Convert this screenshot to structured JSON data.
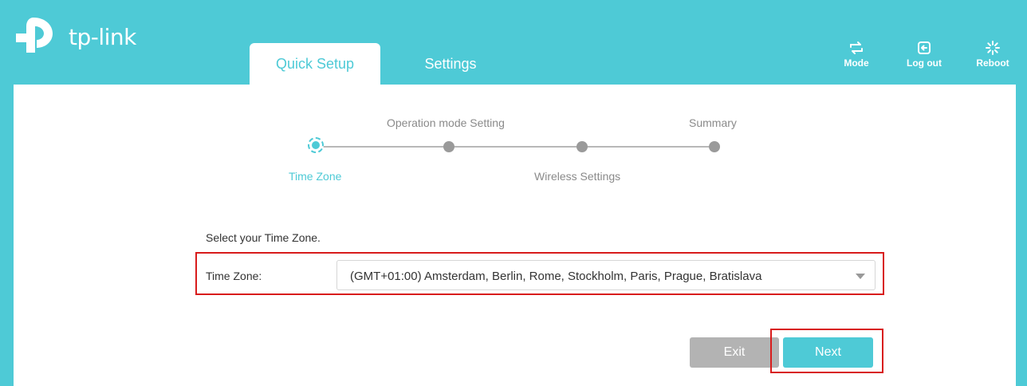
{
  "brand": {
    "logo_text": "tp-link"
  },
  "tabs": [
    {
      "label": "Quick Setup",
      "active": true
    },
    {
      "label": "Settings",
      "active": false
    }
  ],
  "toolbar": {
    "mode_label": "Mode",
    "logout_label": "Log out",
    "reboot_label": "Reboot"
  },
  "steps": [
    {
      "label": "Time Zone",
      "active": true
    },
    {
      "label": "Operation mode Setting",
      "active": false
    },
    {
      "label": "Wireless Settings",
      "active": false
    },
    {
      "label": "Summary",
      "active": false
    }
  ],
  "form": {
    "prompt": "Select your Time Zone.",
    "timezone_label": "Time Zone:",
    "timezone_value": "(GMT+01:00) Amsterdam, Berlin, Rome, Stockholm, Paris, Prague, Bratislava"
  },
  "buttons": {
    "exit_label": "Exit",
    "next_label": "Next"
  },
  "colors": {
    "accent": "#4ecad6",
    "highlight": "#d81c1c",
    "button_disabled": "#b3b3b3"
  }
}
